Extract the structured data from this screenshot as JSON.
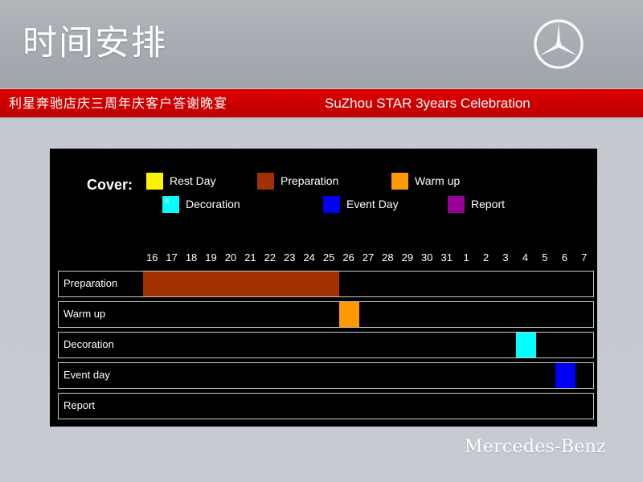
{
  "header": {
    "title": "时间安排",
    "logo_icon": "mercedes-star-icon"
  },
  "banner": {
    "chinese_text": "利星奔驰店庆三周年庆客户答谢晚宴",
    "english_text": "SuZhou STAR 3years Celebration",
    "background_color": "#d00000"
  },
  "footer": {
    "wordmark": "Mercedes-Benz"
  },
  "chart": {
    "legend_title": "Cover:",
    "legend": [
      {
        "label": "Rest Day",
        "color": "#fff200"
      },
      {
        "label": "Preparation",
        "color": "#a33000"
      },
      {
        "label": "Warm up",
        "color": "#ff9900"
      },
      {
        "label": "Decoration",
        "color": "#00ffff"
      },
      {
        "label": "Event Day",
        "color": "#0000f5"
      },
      {
        "label": "Report",
        "color": "#990099"
      }
    ]
  },
  "chart_data": {
    "type": "bar",
    "chart_subtype": "gantt",
    "title": "时间安排",
    "xlabel": "",
    "ylabel": "",
    "grid": false,
    "legend_position": "top",
    "background": "#000000",
    "categories": [
      "Preparation",
      "Warm up",
      "Decoration",
      "Event day",
      "Report"
    ],
    "x_tick_labels": [
      "16",
      "17",
      "18",
      "19",
      "20",
      "21",
      "22",
      "23",
      "24",
      "25",
      "26",
      "27",
      "28",
      "29",
      "30",
      "31",
      "1",
      "2",
      "3",
      "4",
      "5",
      "6",
      "7"
    ],
    "x_axis_days": 23,
    "series": [
      {
        "name": "Preparation",
        "row": 0,
        "start_index": 0,
        "end_index": 10,
        "start_label": "16",
        "end_label": "25",
        "color": "#a33000"
      },
      {
        "name": "Warm up",
        "row": 1,
        "start_index": 10,
        "end_index": 11,
        "start_label": "26",
        "end_label": "26",
        "color": "#ff9900"
      },
      {
        "name": "Decoration",
        "row": 2,
        "start_index": 19,
        "end_index": 20,
        "start_label": "4",
        "end_label": "4",
        "color": "#00ffff"
      },
      {
        "name": "Event day",
        "row": 3,
        "start_index": 21,
        "end_index": 22,
        "start_label": "6",
        "end_label": "6",
        "color": "#0000f5"
      },
      {
        "name": "Report",
        "row": 4,
        "start_index": null,
        "end_index": null,
        "start_label": "",
        "end_label": "",
        "color": "#990099"
      }
    ]
  }
}
